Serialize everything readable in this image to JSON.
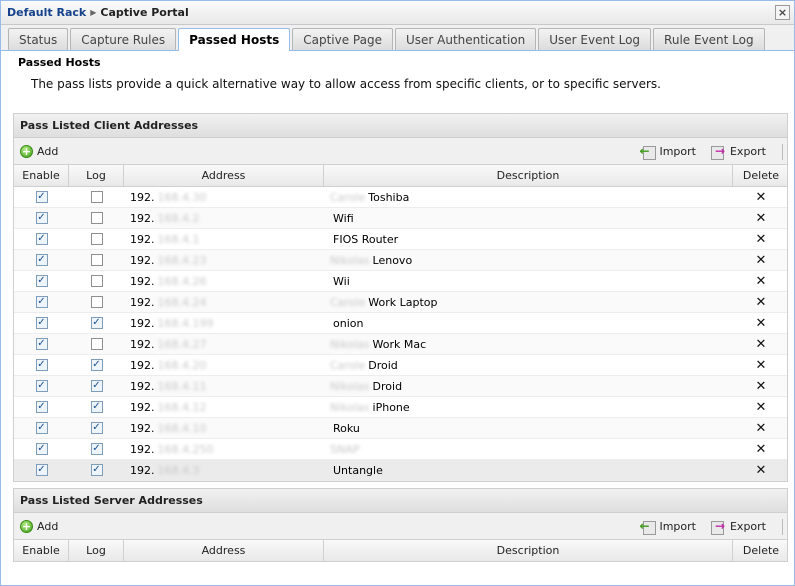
{
  "window": {
    "breadcrumb_root": "Default Rack",
    "breadcrumb_current": "Captive Portal",
    "close_label": "×"
  },
  "tabs": [
    {
      "label": "Status",
      "active": false
    },
    {
      "label": "Capture Rules",
      "active": false
    },
    {
      "label": "Passed Hosts",
      "active": true
    },
    {
      "label": "Captive Page",
      "active": false
    },
    {
      "label": "User Authentication",
      "active": false
    },
    {
      "label": "User Event Log",
      "active": false
    },
    {
      "label": "Rule Event Log",
      "active": false
    }
  ],
  "page": {
    "title": "Passed Hosts",
    "description": "The pass lists provide a quick alternative way to allow access from specific clients, or to specific servers."
  },
  "client_section": {
    "title": "Pass Listed Client Addresses",
    "add_label": "Add",
    "import_label": "Import",
    "export_label": "Export",
    "columns": [
      "Enable",
      "Log",
      "Address",
      "Description",
      "Delete"
    ],
    "rows": [
      {
        "enable": true,
        "log": false,
        "address": "192.",
        "address_hidden": "168.4.30",
        "desc_hidden": "Carole",
        "description": "Toshiba"
      },
      {
        "enable": true,
        "log": false,
        "address": "192.",
        "address_hidden": "168.4.2",
        "desc_hidden": "",
        "description": "Wifi"
      },
      {
        "enable": true,
        "log": false,
        "address": "192.",
        "address_hidden": "168.4.1",
        "desc_hidden": "",
        "description": "FIOS Router"
      },
      {
        "enable": true,
        "log": false,
        "address": "192.",
        "address_hidden": "168.4.23",
        "desc_hidden": "Nikolas",
        "description": "Lenovo"
      },
      {
        "enable": true,
        "log": false,
        "address": "192.",
        "address_hidden": "168.4.26",
        "desc_hidden": "",
        "description": "Wii"
      },
      {
        "enable": true,
        "log": false,
        "address": "192.",
        "address_hidden": "168.4.24",
        "desc_hidden": "Carole",
        "description": "Work Laptop"
      },
      {
        "enable": true,
        "log": true,
        "address": "192.",
        "address_hidden": "168.4.199",
        "desc_hidden": "",
        "description": "onion"
      },
      {
        "enable": true,
        "log": false,
        "address": "192.",
        "address_hidden": "168.4.27",
        "desc_hidden": "Nikolas",
        "description": "Work Mac"
      },
      {
        "enable": true,
        "log": true,
        "address": "192.",
        "address_hidden": "168.4.20",
        "desc_hidden": "Carole",
        "description": "Droid"
      },
      {
        "enable": true,
        "log": true,
        "address": "192.",
        "address_hidden": "168.4.11",
        "desc_hidden": "Nikolas",
        "description": "Droid"
      },
      {
        "enable": true,
        "log": true,
        "address": "192.",
        "address_hidden": "168.4.12",
        "desc_hidden": "Nikolas",
        "description": "iPhone"
      },
      {
        "enable": true,
        "log": true,
        "address": "192.",
        "address_hidden": "168.4.10",
        "desc_hidden": "",
        "description": "Roku"
      },
      {
        "enable": true,
        "log": true,
        "address": "192.",
        "address_hidden": "168.4.250",
        "desc_hidden": "SNAP",
        "description": ""
      },
      {
        "enable": true,
        "log": true,
        "address": "192.",
        "address_hidden": "168.4.3",
        "desc_hidden": "",
        "description": "Untangle"
      }
    ]
  },
  "server_section": {
    "title": "Pass Listed Server Addresses",
    "add_label": "Add",
    "import_label": "Import",
    "export_label": "Export",
    "columns": [
      "Enable",
      "Log",
      "Address",
      "Description",
      "Delete"
    ]
  },
  "icons": {
    "check": "✓",
    "delete": "✕",
    "add": "+",
    "breadcrumb_arrow": "▶"
  }
}
